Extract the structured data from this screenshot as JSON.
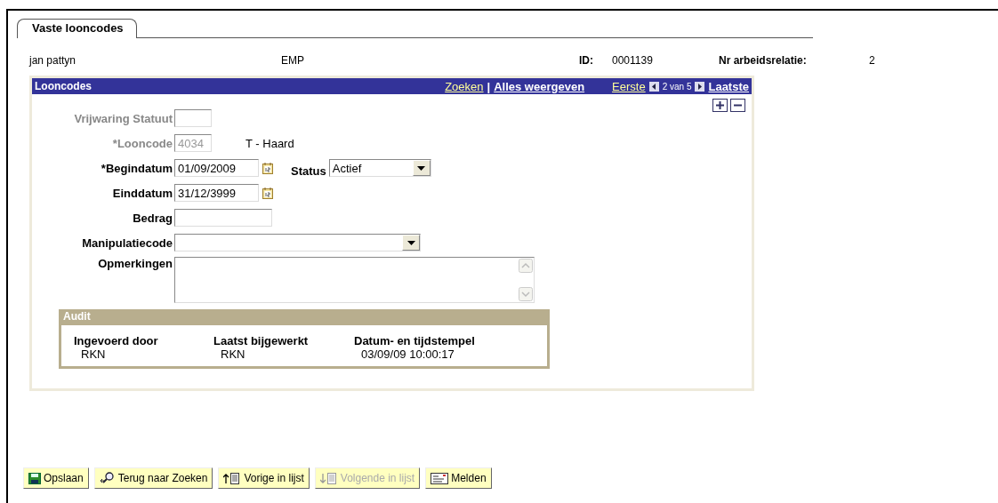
{
  "tabs": [
    {
      "label": "Vaste looncodes",
      "selected": true
    }
  ],
  "header": {
    "name": "jan pattyn",
    "type": "EMP",
    "id_label": "ID:",
    "id_value": "0001139",
    "relation_label": "Nr arbeidsrelatie:",
    "relation_value": "2"
  },
  "grid": {
    "title": "Looncodes",
    "search_link": "Zoeken",
    "separator": "|",
    "show_all_link": "Alles weergeven",
    "first_link": "Eerste",
    "position": "2 van 5",
    "last_link": "Laatste"
  },
  "fields": [
    {
      "kind": "code",
      "label": "Vrijwaring Statuut",
      "disabled": true
    },
    {
      "kind": "code",
      "label": "*Looncode",
      "disabled": true,
      "value": "4034",
      "description": "T - Haard"
    },
    {
      "kind": "date",
      "label": "*Begindatum",
      "disabled": false,
      "value": "01/09/2009",
      "side": {
        "label": "Status",
        "value": "Actief"
      }
    },
    {
      "kind": "date",
      "label": "Einddatum",
      "disabled": false,
      "value": "31/12/3999"
    },
    {
      "kind": "amount",
      "label": "Bedrag",
      "disabled": false
    },
    {
      "kind": "select",
      "label": "Manipulatiecode",
      "disabled": false
    },
    {
      "kind": "textarea",
      "label": "Opmerkingen",
      "disabled": false
    }
  ],
  "audit": {
    "title": "Audit",
    "columns": [
      {
        "heading": "Ingevoerd door",
        "value": "RKN"
      },
      {
        "heading": "Laatst bijgewerkt",
        "value": "RKN"
      },
      {
        "heading": "Datum- en tijdstempel",
        "value": "03/09/09 10:00:17"
      }
    ]
  },
  "buttons": [
    {
      "kind": "save",
      "label": "Opslaan",
      "disabled": false
    },
    {
      "kind": "search",
      "label": "Terug naar Zoeken",
      "disabled": false
    },
    {
      "kind": "previous",
      "label": "Vorige in lijst",
      "disabled": false
    },
    {
      "kind": "next",
      "label": "Volgende in lijst",
      "disabled": true
    },
    {
      "kind": "notify",
      "label": "Melden",
      "disabled": false
    }
  ]
}
